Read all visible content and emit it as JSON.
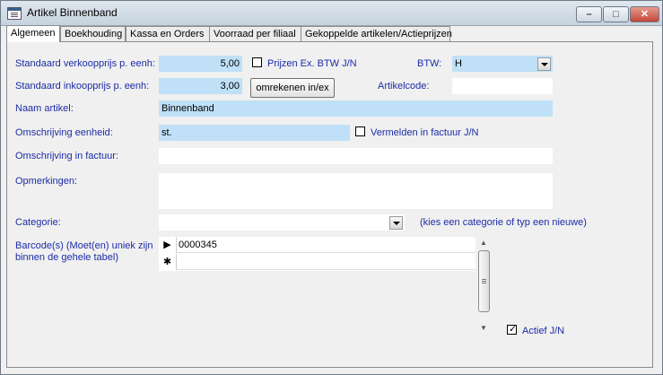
{
  "window": {
    "title": "Artikel Binnenband",
    "minimize_glyph": "–",
    "maximize_glyph": "□",
    "close_glyph": "✕"
  },
  "tabs": [
    {
      "label": "Algemeen",
      "active": true
    },
    {
      "label": "Boekhouding",
      "active": false
    },
    {
      "label": "Kassa en Orders",
      "active": false
    },
    {
      "label": "Voorraad per filiaal",
      "active": false
    },
    {
      "label": "Gekoppelde artikelen/Actieprijzen",
      "active": false
    }
  ],
  "form": {
    "verkoopprijs": {
      "label": "Standaard verkoopprijs p. eenh:",
      "value": "5,00"
    },
    "prijzen_ex_btw": {
      "label": "Prijzen Ex. BTW J/N",
      "checked": false
    },
    "btw": {
      "label": "BTW:",
      "value": "H"
    },
    "inkoopprijs": {
      "label": "Standaard inkoopprijs p. eenh:",
      "value": "3,00"
    },
    "omrekenen_button": "omrekenen in/ex",
    "artikelcode": {
      "label": "Artikelcode:",
      "value": ""
    },
    "naam": {
      "label": "Naam artikel:",
      "value": "Binnenband"
    },
    "eenheid": {
      "label": "Omschrijving eenheid:",
      "value": "st."
    },
    "vermelden": {
      "label": "Vermelden in factuur J/N",
      "checked": false
    },
    "omschrijving_factuur": {
      "label": "Omschrijving in factuur:",
      "value": ""
    },
    "opmerkingen": {
      "label": "Opmerkingen:",
      "value": ""
    },
    "categorie": {
      "label": "Categorie:",
      "value": "",
      "hint": "(kies een categorie of typ een nieuwe)"
    },
    "barcodes": {
      "label_line1": "Barcode(s) (Moet(en) uniek zijn",
      "label_line2": "binnen de gehele tabel)",
      "rows": [
        {
          "selector": "▶",
          "value": "0000345"
        }
      ],
      "new_row_selector": "✱"
    },
    "actief": {
      "label": "Actief J/N",
      "checked": true
    }
  },
  "colors": {
    "label": "#1c2ca6",
    "field_highlight": "#bfe0f7"
  }
}
